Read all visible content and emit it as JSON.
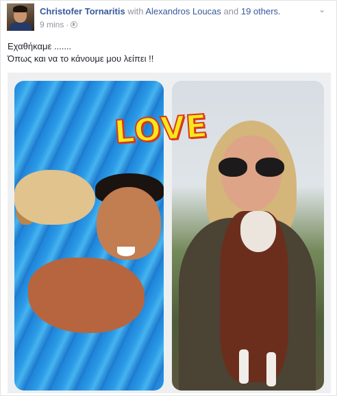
{
  "post": {
    "author": "Christofer Tornaritis",
    "with_text": " with ",
    "tagged_person": "Alexandros Loucas",
    "and_text": " and ",
    "others_link": "19 others.",
    "timestamp": "9 mins",
    "separator": "·",
    "privacy_icon": "globe-icon",
    "menu_icon": "chevron-down-icon",
    "text_line1": "Εχαθήκαμε .......",
    "text_line2": "Όπως και να το κάνουμε μου λείπει !!"
  },
  "photo": {
    "overlay_text": "LOVE"
  },
  "colors": {
    "link": "#365899",
    "meta": "#90949c",
    "text": "#1d2129",
    "love_fill": "#f6e81a",
    "love_outline": "#d9381e"
  }
}
